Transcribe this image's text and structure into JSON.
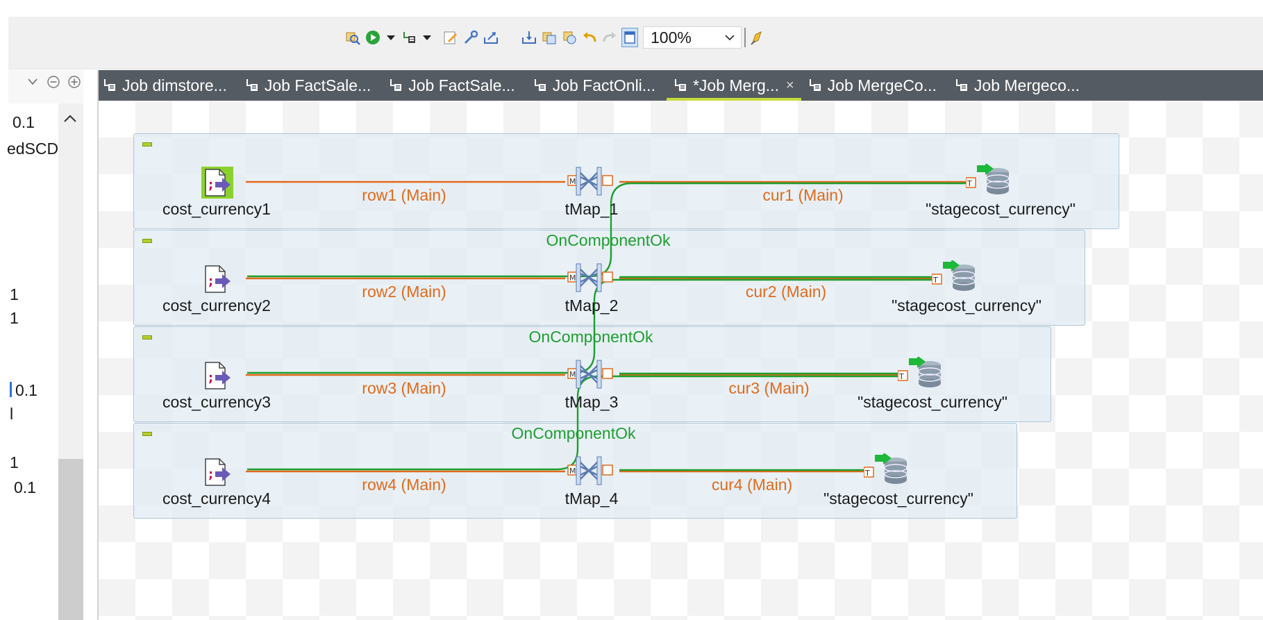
{
  "toolbar": {
    "zoom": "100%"
  },
  "left": {
    "rows": [
      "0.1",
      "edSCD",
      "1",
      "1",
      "0.1",
      "l",
      "1",
      "0.1"
    ]
  },
  "tabs": [
    {
      "label": "Job dimstore..."
    },
    {
      "label": "Job FactSale..."
    },
    {
      "label": "Job FactSale..."
    },
    {
      "label": "Job FactOnli..."
    },
    {
      "label": "*Job Merg...",
      "close": "×"
    },
    {
      "label": "Job MergeCo..."
    },
    {
      "label": "Job Mergeco..."
    }
  ],
  "job": {
    "subjobs": [
      {
        "input": "cost_currency1",
        "map": "tMap_1",
        "output": "\"stagecost_currency\"",
        "in_flow": "row1 (Main)",
        "out_flow": "cur1 (Main)"
      },
      {
        "input": "cost_currency2",
        "map": "tMap_2",
        "output": "\"stagecost_currency\"",
        "in_flow": "row2 (Main)",
        "out_flow": "cur2 (Main)"
      },
      {
        "input": "cost_currency3",
        "map": "tMap_3",
        "output": "\"stagecost_currency\"",
        "in_flow": "row3 (Main)",
        "out_flow": "cur3 (Main)"
      },
      {
        "input": "cost_currency4",
        "map": "tMap_4",
        "output": "\"stagecost_currency\"",
        "in_flow": "row4 (Main)",
        "out_flow": "cur4 (Main)"
      }
    ],
    "triggers": [
      "OnComponentOk",
      "OnComponentOk",
      "OnComponentOk"
    ]
  },
  "colors": {
    "main_flow": "#e06a1a",
    "trigger": "#1e9e2e",
    "tab_bar": "#555b63",
    "tab_active_underline": "#c6dc3c"
  }
}
